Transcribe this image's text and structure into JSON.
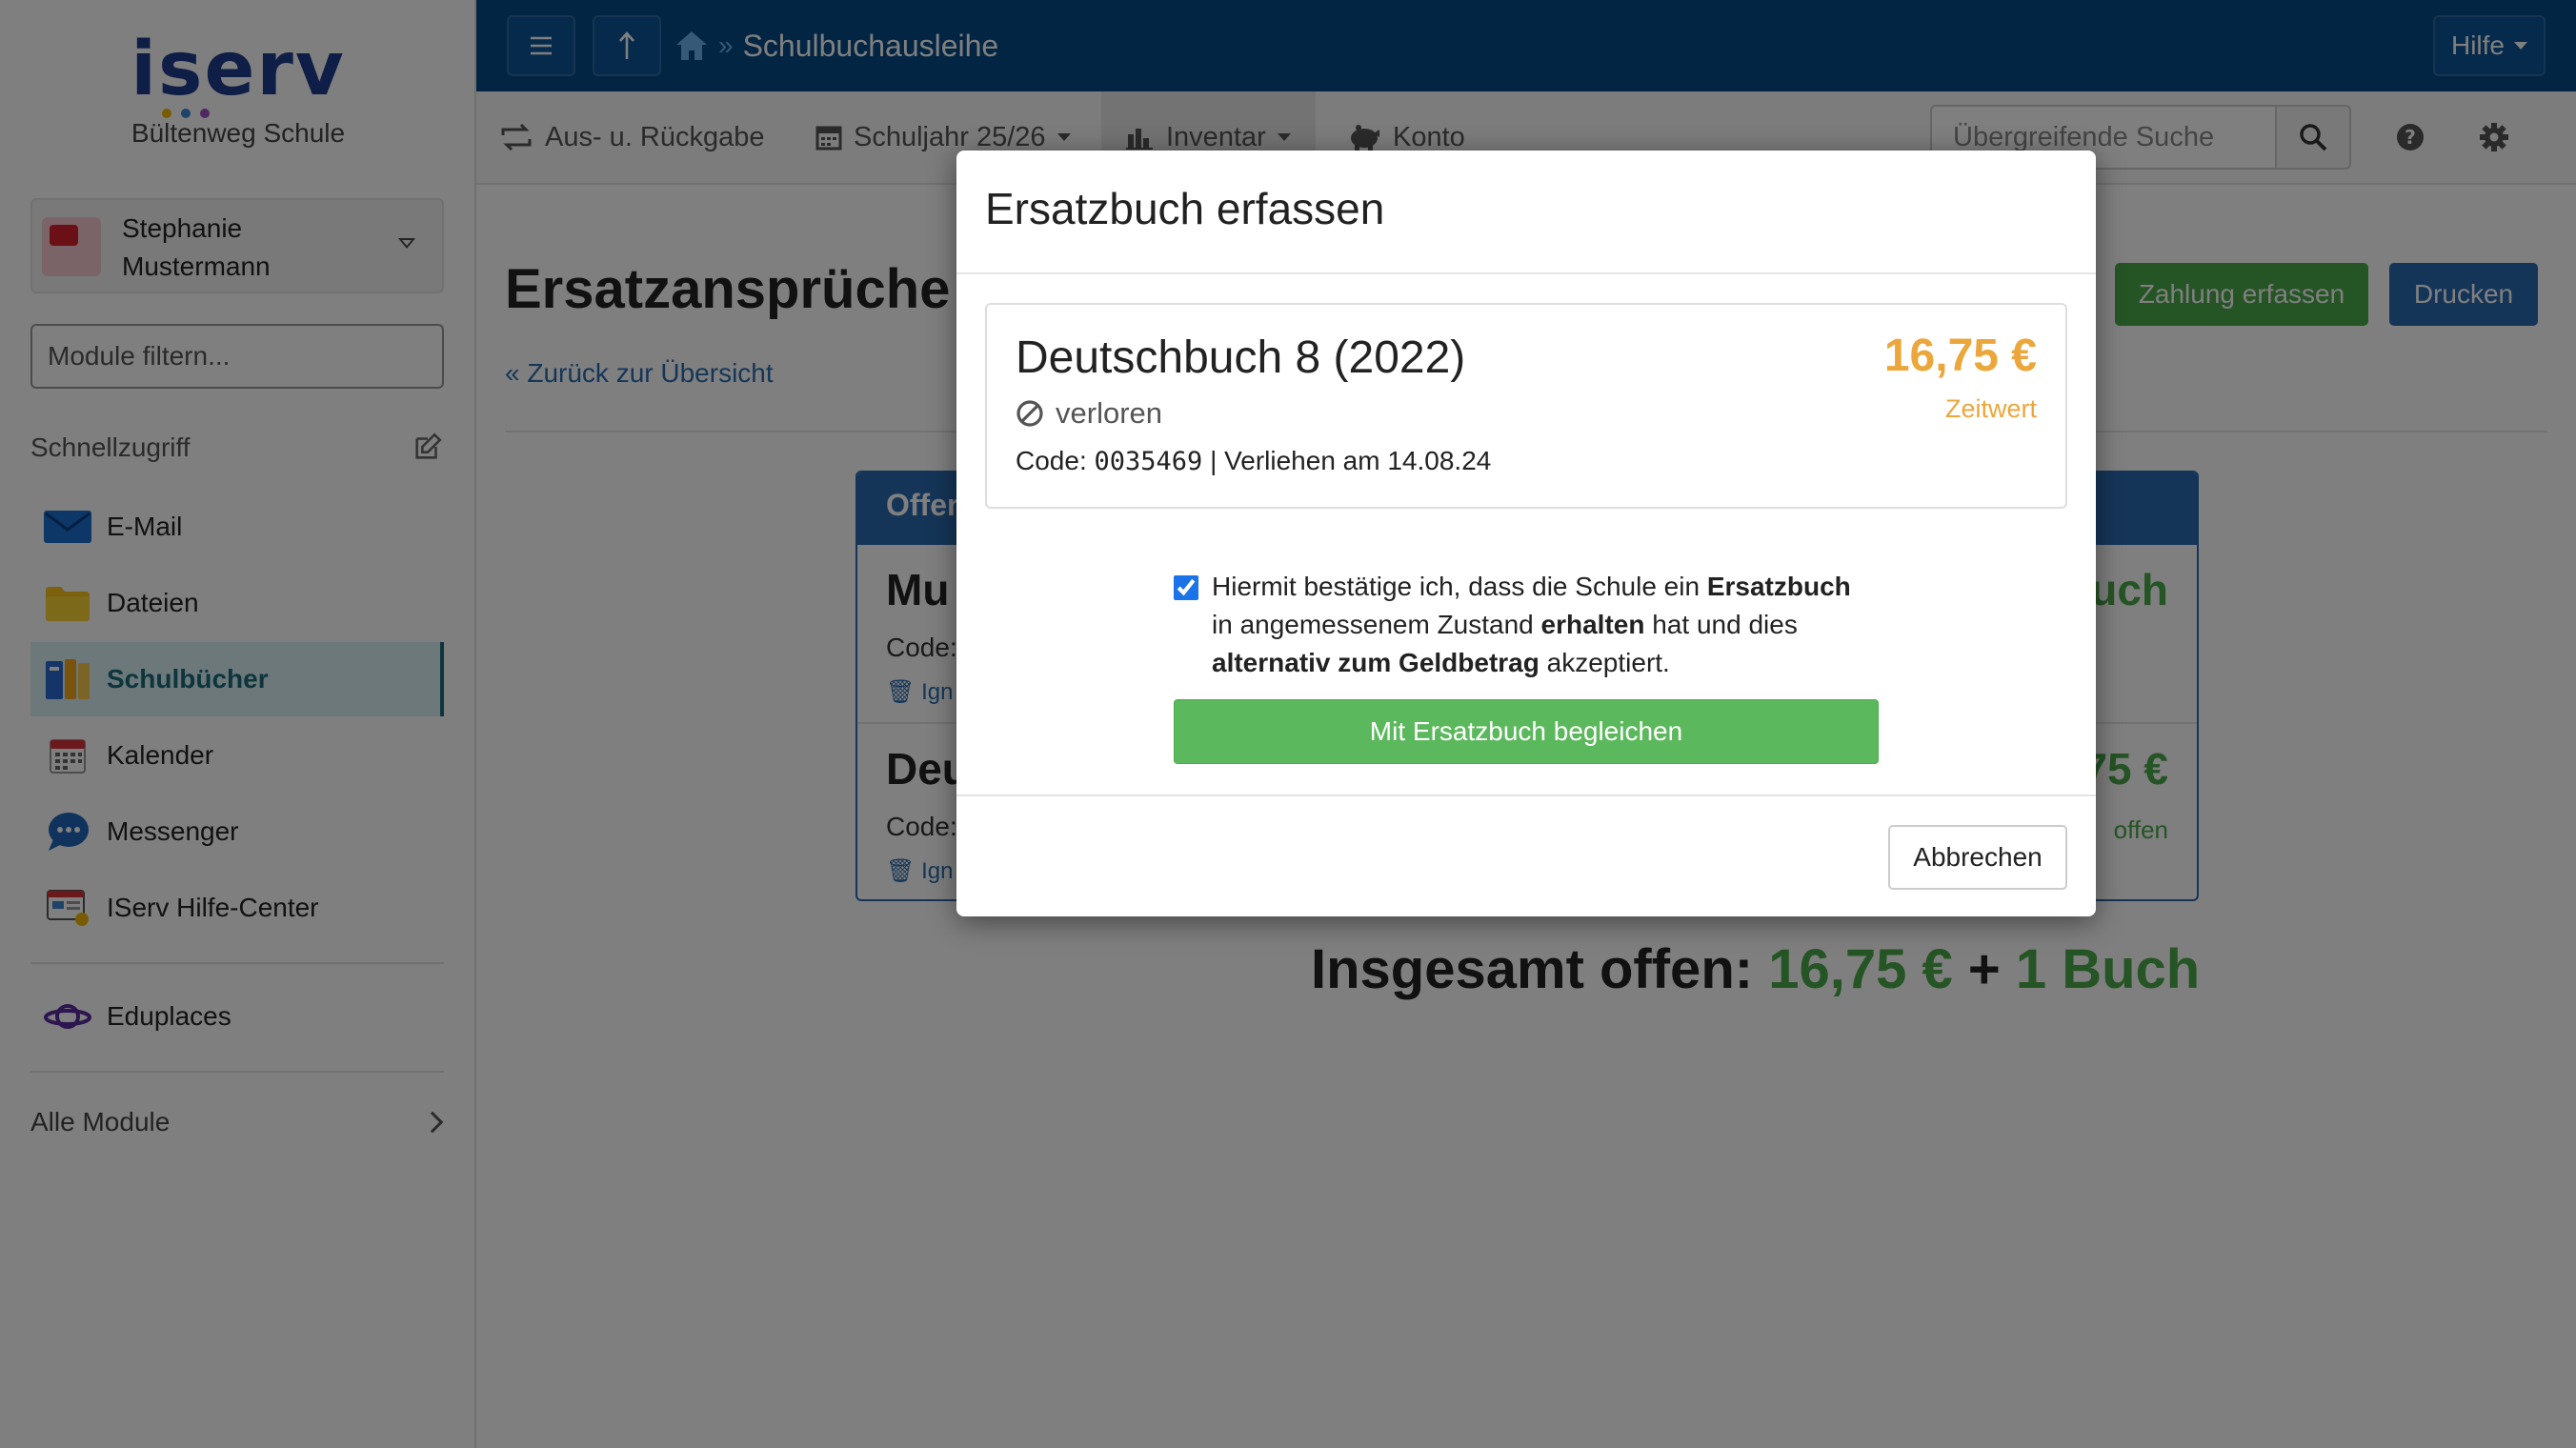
{
  "sidebar": {
    "logo_text": "iserv",
    "school": "Bültenweg Schule",
    "user": {
      "name": "Stephanie Mustermann"
    },
    "filter_placeholder": "Module filtern...",
    "quick_access_label": "Schnellzugriff",
    "items": [
      {
        "label": "E-Mail",
        "icon": "mail-icon"
      },
      {
        "label": "Dateien",
        "icon": "folder-icon"
      },
      {
        "label": "Schulbücher",
        "icon": "books-icon",
        "active": true
      },
      {
        "label": "Kalender",
        "icon": "calendar-icon"
      },
      {
        "label": "Messenger",
        "icon": "chat-bubble-icon"
      },
      {
        "label": "IServ Hilfe-Center",
        "icon": "help-center-icon"
      }
    ],
    "extra_item": {
      "label": "Eduplaces",
      "icon": "planet-icon"
    },
    "all_modules_label": "Alle Module"
  },
  "topbar": {
    "breadcrumb_sep": "»",
    "breadcrumb_current": "Schulbuchausleihe",
    "help_label": "Hilfe"
  },
  "subnav": {
    "items": [
      {
        "label": "Aus- u. Rückgabe",
        "icon": "return-icon"
      },
      {
        "label": "Schuljahr 25/26",
        "icon": "calendar-icon",
        "dropdown": true
      },
      {
        "label": "Inventar",
        "icon": "inventory-icon",
        "dropdown": true,
        "active": true
      },
      {
        "label": "Konto",
        "icon": "piggy-bank-icon"
      }
    ],
    "search_placeholder": "Übergreifende Suche"
  },
  "page": {
    "title": "Ersatzansprüche S",
    "back_link": "« Zurück zur Übersicht",
    "pay_button": "Zahlung erfassen",
    "print_button": "Drucken",
    "panel_header": "Offen",
    "rows": [
      {
        "title": "Mu",
        "code": "Code:",
        "ignore": "Ign",
        "right": "uch",
        "right_sub": ""
      },
      {
        "title": "Deu",
        "code": "Code:",
        "ignore": "Ign",
        "right": "75 €",
        "right_sub": "offen"
      }
    ],
    "total_label": "Insgesamt offen:",
    "total_amount": "16,75 €",
    "total_plus": "+",
    "total_books": "1 Buch"
  },
  "modal": {
    "title": "Ersatzbuch erfassen",
    "book": {
      "title": "Deutschbuch 8 (2022)",
      "status": "verloren",
      "code_label": "Code:",
      "code": "0035469",
      "lent": "| Verliehen am 14.08.24",
      "price": "16,75 €",
      "price_label": "Zeitwert"
    },
    "confirm": {
      "t1": "Hiermit bestätige ich, dass die Schule ein ",
      "b1": "Ersatzbuch",
      "t2": "in angemessenem Zustand ",
      "b2": "erhalten",
      "t3": " hat und dies",
      "b3": "alternativ zum Geldbetrag",
      "t4": " akzeptiert.",
      "checked": true
    },
    "settle_button": "Mit Ersatzbuch begleichen",
    "cancel_button": "Abbrechen"
  },
  "colors": {
    "topbar": "#044a87",
    "primary": "#2b6bb0",
    "success": "#5cb85c",
    "warning": "#eba73b",
    "active_nav": "#d8f1f5"
  }
}
